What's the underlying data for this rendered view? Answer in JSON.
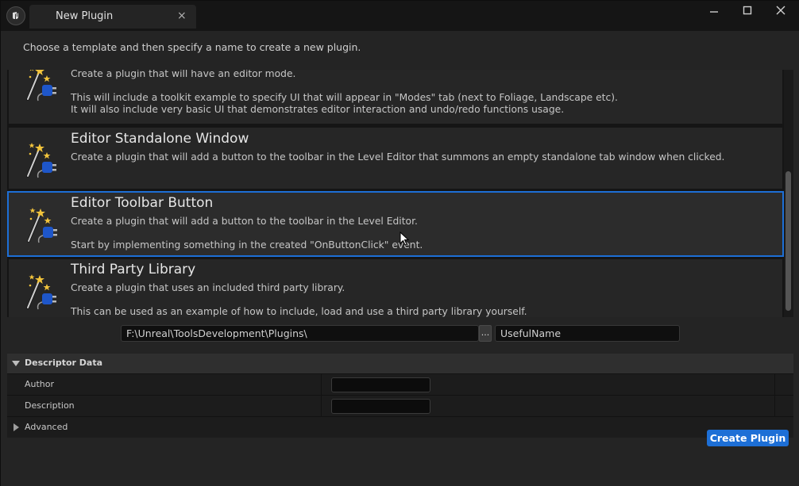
{
  "window": {
    "tab_title": "New Plugin",
    "tab_close": "×",
    "controls": {
      "minimize": "—",
      "maximize": "☐",
      "close": "✕"
    }
  },
  "intro": "Choose a template and then specify a name to create a new plugin.",
  "templates": [
    {
      "title": "",
      "description": "Create a plugin that will have an editor mode.\n\nThis will include a toolkit example to specify UI that will appear in \"Modes\" tab (next to Foliage, Landscape etc).\nIt will also include very basic UI that demonstrates editor interaction and undo/redo functions usage.",
      "icon": "plugin-wand-icon"
    },
    {
      "title": "Editor Standalone Window",
      "description": "Create a plugin that will add a button to the toolbar in the Level Editor that summons an empty standalone tab window when clicked.",
      "icon": "plugin-wand-icon"
    },
    {
      "title": "Editor Toolbar Button",
      "description": "Create a plugin that will add a button to the toolbar in the Level Editor.\n\nStart by implementing something in the created \"OnButtonClick\" event.",
      "icon": "plugin-wand-icon",
      "selected": true
    },
    {
      "title": "Third Party Library",
      "description": "Create a plugin that uses an included third party library.\n\nThis can be used as an example of how to include, load and use a third party library yourself.",
      "icon": "plugin-wand-icon"
    }
  ],
  "path": {
    "value": "F:\\Unreal\\ToolsDevelopment\\Plugins\\",
    "browse_label": "..."
  },
  "plugin_name": "UsefulName",
  "descriptor": {
    "header": "Descriptor Data",
    "author_label": "Author",
    "author_value": "",
    "description_label": "Description",
    "description_value": "",
    "advanced_label": "Advanced"
  },
  "create_button": "Create Plugin",
  "colors": {
    "accent": "#1d6fd6",
    "background": "#242424"
  }
}
